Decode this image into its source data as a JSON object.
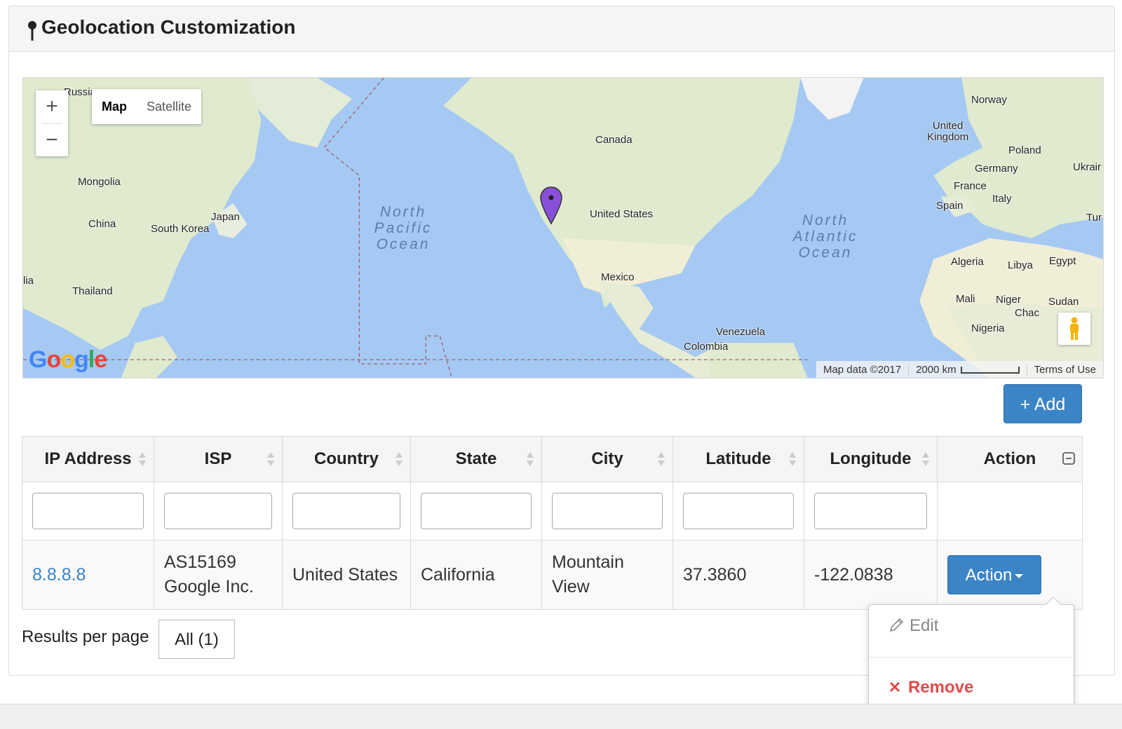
{
  "panel": {
    "title": "Geolocation Customization"
  },
  "map": {
    "zoom_in": "+",
    "zoom_out": "−",
    "map_types": [
      "Map",
      "Satellite"
    ],
    "labels": {
      "russia": "Russia",
      "mongolia": "Mongolia",
      "china": "China",
      "japan": "Japan",
      "south_korea": "South Korea",
      "thailand": "Thailand",
      "india_partial": "lia",
      "canada": "Canada",
      "united_states": "United States",
      "mexico": "Mexico",
      "venezuela": "Venezuela",
      "colombia": "Colombia",
      "norway": "Norway",
      "united_kingdom": "United\nKingdom",
      "poland": "Poland",
      "germany": "Germany",
      "ukraine": "Ukrair",
      "france": "France",
      "italy": "Italy",
      "spain": "Spain",
      "turkey": "Tur",
      "algeria": "Algeria",
      "libya": "Libya",
      "egypt": "Egypt",
      "mali": "Mali",
      "niger": "Niger",
      "sudan": "Sudan",
      "chad": "Chac",
      "nigeria": "Nigeria"
    },
    "oceans": {
      "north_pacific": "North\nPacific\nOcean",
      "north_atlantic": "North\nAtlantic\nOcean"
    },
    "attribution": {
      "map_data": "Map data ©2017",
      "scale": "2000 km",
      "terms": "Terms of Use"
    },
    "logo": "Google"
  },
  "add_button": "+ Add",
  "table": {
    "columns": [
      "IP Address",
      "ISP",
      "Country",
      "State",
      "City",
      "Latitude",
      "Longitude",
      "Action"
    ],
    "row": {
      "ip": "8.8.8.8",
      "isp_line1": "AS15169",
      "isp_line2": "Google Inc.",
      "country": "United States",
      "state": "California",
      "city_line1": "Mountain",
      "city_line2": "View",
      "latitude": "37.3860",
      "longitude": "-122.0838",
      "action": "Action"
    }
  },
  "pagination": {
    "label": "Results per page",
    "value": "All (1)"
  },
  "dropdown": {
    "edit": "Edit",
    "remove": "Remove"
  },
  "colors": {
    "primary": "#3b84c5",
    "danger": "#e24a4a",
    "ocean": "#a5c9f2",
    "land": "#e7eedc",
    "marker": "#8a4fd8"
  }
}
